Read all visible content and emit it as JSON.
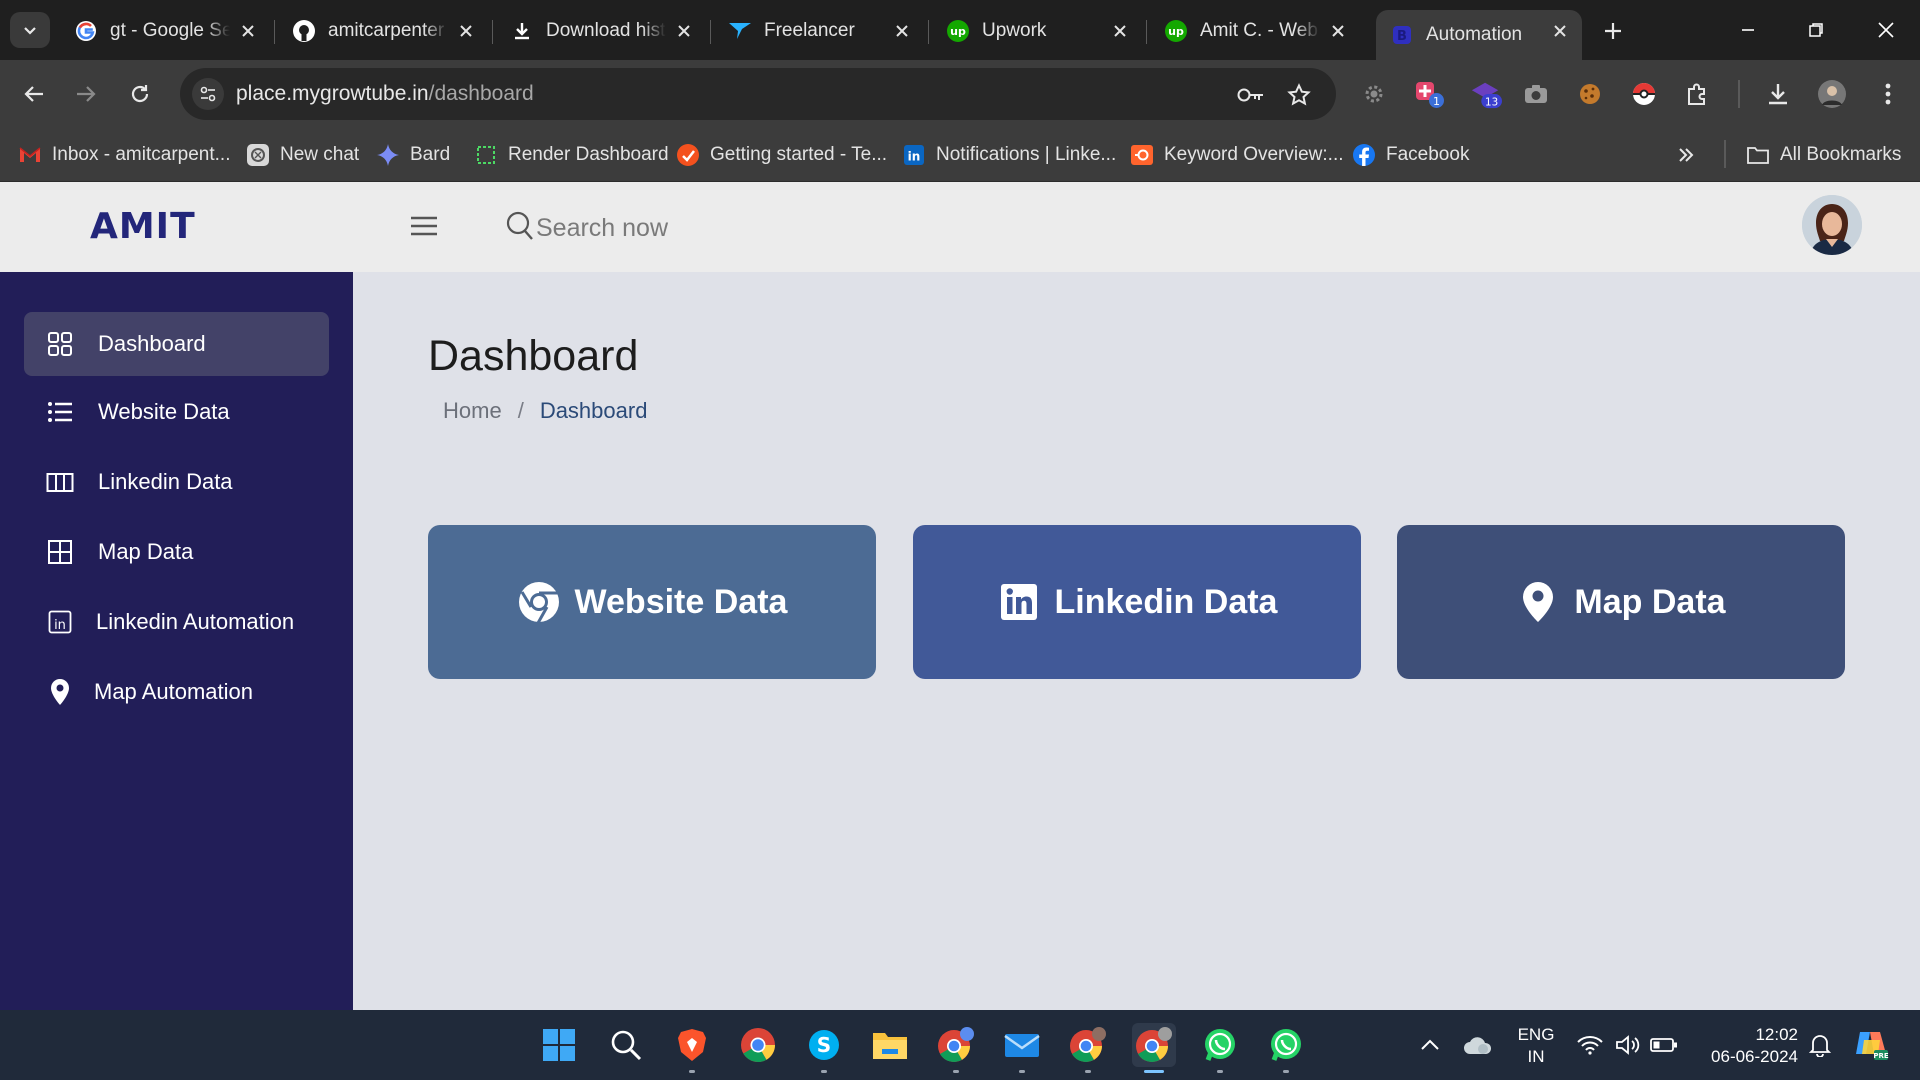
{
  "browser": {
    "tabs": [
      {
        "title": "gt - Google Search",
        "icon": "google-icon",
        "active": false
      },
      {
        "title": "amitcarpenter",
        "icon": "github-icon",
        "active": false
      },
      {
        "title": "Download history",
        "icon": "download-icon",
        "active": false
      },
      {
        "title": "Freelancer",
        "icon": "freelancer-icon",
        "active": false
      },
      {
        "title": "Upwork",
        "icon": "upwork-icon",
        "active": false
      },
      {
        "title": "Amit C. - Web",
        "icon": "upwork-icon",
        "active": false
      },
      {
        "title": "Automation",
        "icon": "bootstrap-icon",
        "active": true
      }
    ],
    "url": {
      "host": "place.mygrowtube.in",
      "path": "/dashboard"
    },
    "extension_badges": {
      "ext_a": "1",
      "ext_b": "13"
    },
    "bookmarks": [
      {
        "label": "Inbox - amitcarpent...",
        "icon": "gmail-icon"
      },
      {
        "label": "New chat",
        "icon": "chatgpt-icon"
      },
      {
        "label": "Bard",
        "icon": "bard-icon"
      },
      {
        "label": "Render Dashboard",
        "icon": "render-icon"
      },
      {
        "label": "Getting started - Te...",
        "icon": "getting-started-icon"
      },
      {
        "label": "Notifications | Linke...",
        "icon": "linkedin-icon"
      },
      {
        "label": "Keyword Overview:...",
        "icon": "semrush-icon"
      },
      {
        "label": "Facebook",
        "icon": "facebook-icon"
      }
    ],
    "all_bookmarks_label": "All Bookmarks"
  },
  "app": {
    "logo": "AMIT",
    "search_placeholder": "Search now",
    "sidebar": [
      {
        "label": "Dashboard",
        "icon": "grid-icon",
        "active": true
      },
      {
        "label": "Website Data",
        "icon": "list-icon",
        "active": false
      },
      {
        "label": "Linkedin Data",
        "icon": "columns-icon",
        "active": false
      },
      {
        "label": "Map Data",
        "icon": "table-icon",
        "active": false
      },
      {
        "label": "Linkedin Automation",
        "icon": "linkedin-icon",
        "active": false
      },
      {
        "label": "Map Automation",
        "icon": "map-pin-icon",
        "active": false
      }
    ],
    "page_title": "Dashboard",
    "breadcrumb": {
      "home": "Home",
      "separator": "/",
      "current": "Dashboard"
    },
    "cards": [
      {
        "label": "Website Data",
        "icon": "chrome-icon",
        "color": "#4c6b94"
      },
      {
        "label": "Linkedin Data",
        "icon": "linkedin-icon",
        "color": "#415998"
      },
      {
        "label": "Map Data",
        "icon": "map-pin-icon",
        "color": "#3e4f78"
      }
    ],
    "colors": {
      "sidebar": "#221e58",
      "active_item": "#434268",
      "logo": "#23267a",
      "breadcrumb_current": "#2b4a78"
    }
  },
  "taskbar": {
    "apps": [
      "windows-start-icon",
      "search-icon",
      "brave-icon",
      "chrome-icon",
      "skype-icon",
      "file-explorer-icon",
      "chrome-profile-icon",
      "mail-icon",
      "chrome-profile-icon",
      "chrome-profile-icon",
      "whatsapp-icon",
      "whatsapp-icon"
    ],
    "language": {
      "line1": "ENG",
      "line2": "IN"
    },
    "time": "12:02",
    "date": "06-06-2024"
  }
}
